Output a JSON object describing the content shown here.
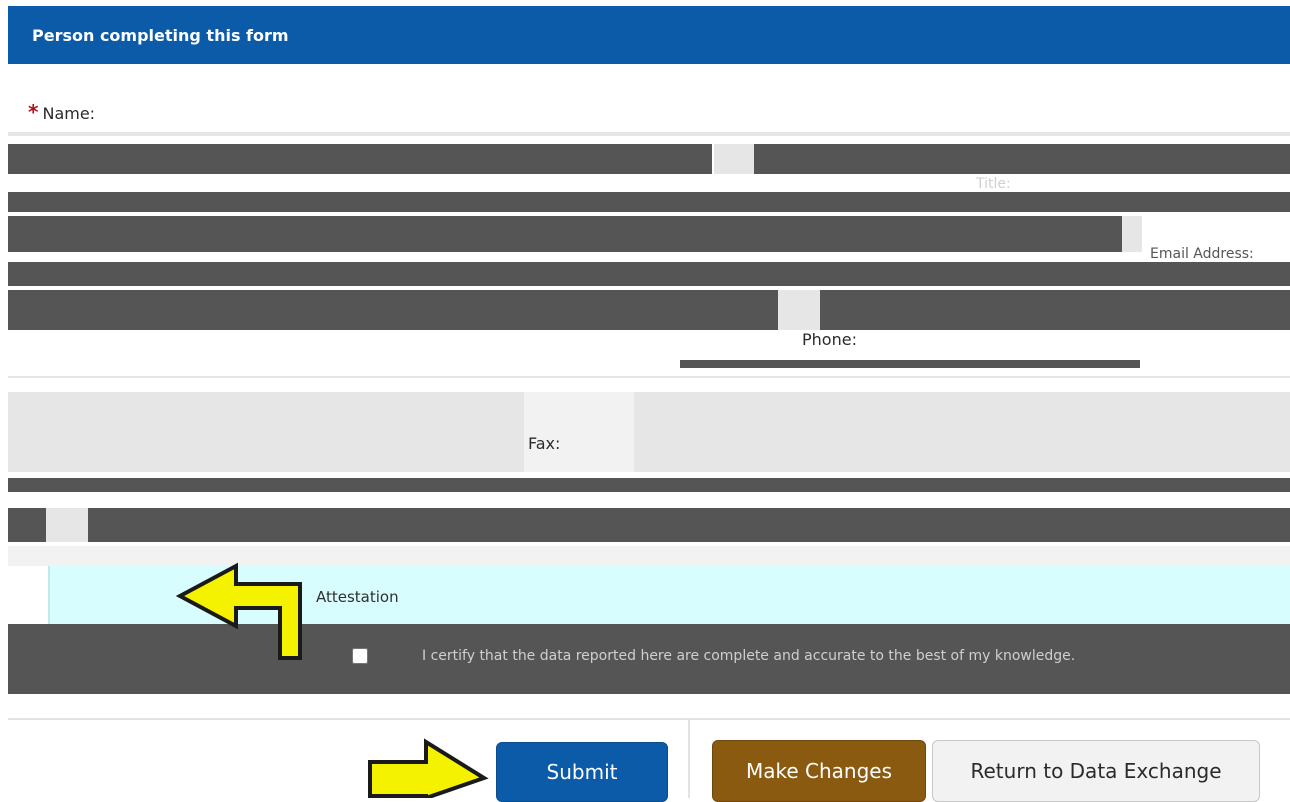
{
  "section": {
    "title": "Person completing this form"
  },
  "fields": {
    "required_marker": "*",
    "name_label": "Name:",
    "title_label": "Title:",
    "email_label": "Email Address:",
    "phone_label": "Phone:",
    "fax_label": "Fax:"
  },
  "attestation": {
    "title": "Attestation",
    "statement": "I certify that the data reported here are complete and accurate to the best of my knowledge."
  },
  "buttons": {
    "submit": "Submit",
    "make_changes": "Make Changes",
    "return": "Return to Data Exchange"
  },
  "colors": {
    "header_blue": "#0b5ba8",
    "required_red": "#b0121b",
    "make_changes_brown": "#8a5a10",
    "attestation_band": "#d8fdff",
    "arrow_yellow": "#f5f200"
  },
  "icons": {
    "pointer_arrow_top": "arrow-left-icon",
    "pointer_arrow_bottom": "arrow-right-icon"
  }
}
